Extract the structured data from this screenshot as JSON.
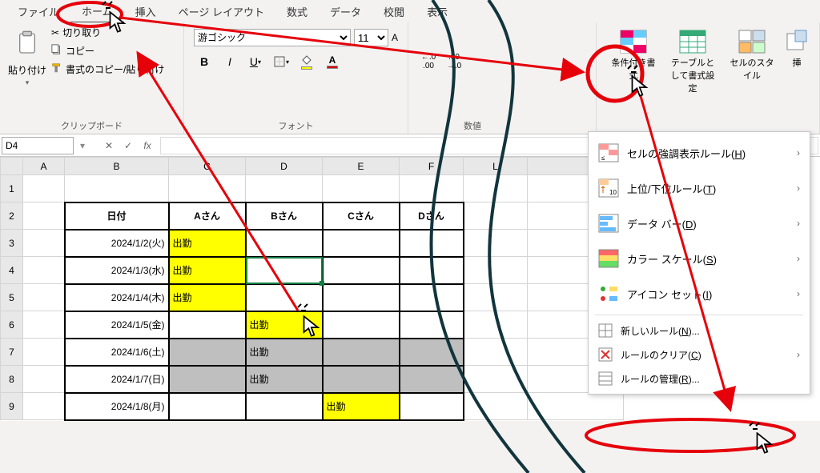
{
  "tabs": {
    "file": "ファイル",
    "home": "ホーム",
    "insert": "挿入",
    "layout": "ページ レイアウト",
    "formulas": "数式",
    "data": "データ",
    "review": "校閲",
    "view": "表示"
  },
  "ribbon": {
    "clipboard": {
      "paste": "貼り付け",
      "cut": "切り取り",
      "copy": "コピー",
      "fmtpaint": "書式のコピー/貼り付け",
      "label": "クリップボード"
    },
    "font": {
      "name": "游ゴシック",
      "size": "11",
      "label": "フォント"
    },
    "number": {
      "inc": ".00",
      "dec": ".0",
      "label": "数値"
    },
    "styles": {
      "cond": "条件付き書式",
      "as_table": "テーブルとして書式設定",
      "cellstyle": "セルのスタイル",
      "insert": "挿"
    }
  },
  "namebox": "D4",
  "columns": {
    "A": "A",
    "B": "B",
    "C": "C",
    "D": "D",
    "E": "E",
    "F": "F",
    "L": "L",
    "G": ""
  },
  "rows": [
    "1",
    "2",
    "3",
    "4",
    "5",
    "6",
    "7",
    "8",
    "9"
  ],
  "table": {
    "headers": {
      "date": "日付",
      "a": "Aさん",
      "b": "Bさん",
      "c": "Cさん",
      "d": "Dさん"
    },
    "r3_date": "2024/1/2(火)",
    "r3_a": "出勤",
    "r4_date": "2024/1/3(水)",
    "r4_a": "出勤",
    "r5_date": "2024/1/4(木)",
    "r5_a": "出勤",
    "r6_date": "2024/1/5(金)",
    "r6_b": "出勤",
    "r7_date": "2024/1/6(土)",
    "r7_b": "出勤",
    "r8_date": "2024/1/7(日)",
    "r8_b": "出勤",
    "r9_date": "2024/1/8(月)",
    "r9_c": "出勤"
  },
  "menu": {
    "highlight": "セルの強調表示ルール",
    "highlight_hk": "H",
    "topbottom": "上位/下位ルール",
    "topbottom_hk": "T",
    "databars": "データ バー",
    "databars_hk": "D",
    "colorscale": "カラー スケール",
    "colorscale_hk": "S",
    "iconset": "アイコン セット",
    "iconset_hk": "I",
    "newrule": "新しいルール",
    "newrule_hk": "N",
    "clear": "ルールのクリア",
    "clear_hk": "C",
    "manage": "ルールの管理",
    "manage_hk": "R"
  }
}
